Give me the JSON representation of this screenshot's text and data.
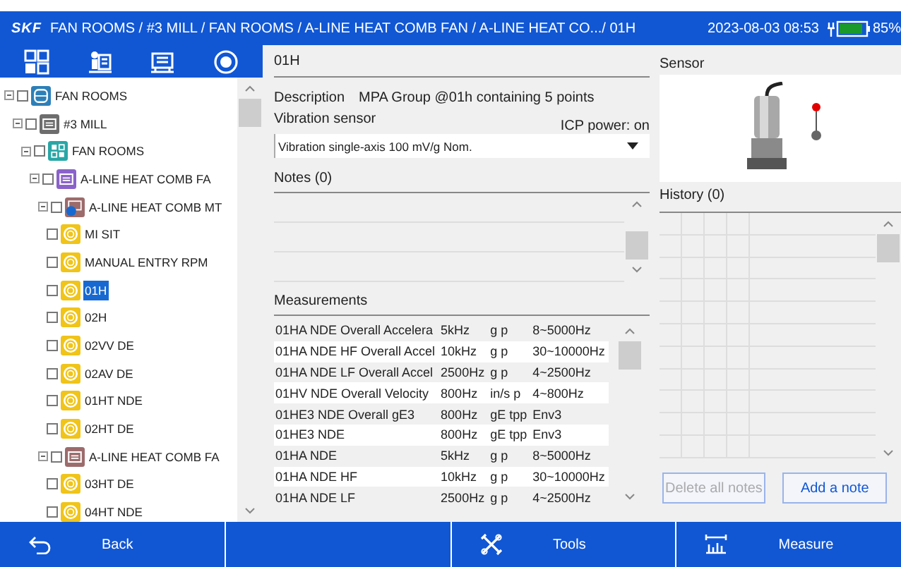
{
  "header": {
    "logo": "SKF",
    "breadcrumb": "FAN ROOMS / #3 MILL / FAN ROOMS / A-LINE HEAT COMB FAN / A-LINE HEAT CO.../ 01H",
    "datetime": "2023-08-03 08:53",
    "battery": "85%"
  },
  "toolbar": [
    {
      "kind": "grid"
    },
    {
      "kind": "machine"
    },
    {
      "kind": "equipment"
    },
    {
      "kind": "target"
    }
  ],
  "tree": [
    {
      "label": "FAN ROOMS",
      "kind": "database",
      "expanded": true,
      "checked": false,
      "selected": false,
      "children": [
        {
          "label": "#3 MILL",
          "kind": "plant",
          "expanded": true,
          "checked": false,
          "selected": false,
          "children": [
            {
              "label": "FAN ROOMS",
              "kind": "group",
              "expanded": true,
              "checked": false,
              "selected": false,
              "children": [
                {
                  "label": "A-LINE HEAT COMB FA",
                  "kind": "machine",
                  "expanded": true,
                  "checked": false,
                  "selected": false,
                  "children": [
                    {
                      "label": "A-LINE HEAT COMB MT",
                      "kind": "submachine",
                      "expanded": true,
                      "checked": false,
                      "selected": false,
                      "children": [
                        {
                          "label": "MI SIT",
                          "kind": "point",
                          "checked": false,
                          "selected": false
                        },
                        {
                          "label": "MANUAL ENTRY RPM",
                          "kind": "point",
                          "checked": false,
                          "selected": false
                        },
                        {
                          "label": "01H",
                          "kind": "point",
                          "checked": false,
                          "selected": true
                        },
                        {
                          "label": "02H",
                          "kind": "point",
                          "checked": false,
                          "selected": false
                        },
                        {
                          "label": "02VV DE",
                          "kind": "point",
                          "checked": false,
                          "selected": false
                        },
                        {
                          "label": "02AV DE",
                          "kind": "point",
                          "checked": false,
                          "selected": false
                        },
                        {
                          "label": "01HT NDE",
                          "kind": "point",
                          "checked": false,
                          "selected": false
                        },
                        {
                          "label": "02HT DE",
                          "kind": "point",
                          "checked": false,
                          "selected": false
                        }
                      ]
                    },
                    {
                      "label": "A-LINE HEAT COMB FA",
                      "kind": "component",
                      "expanded": true,
                      "checked": false,
                      "selected": false,
                      "children": [
                        {
                          "label": "03HT DE",
                          "kind": "point",
                          "checked": false,
                          "selected": false
                        },
                        {
                          "label": "04HT NDE",
                          "kind": "point",
                          "checked": false,
                          "selected": false
                        }
                      ]
                    }
                  ]
                }
              ]
            }
          ]
        }
      ]
    }
  ],
  "detail": {
    "title": "01H",
    "description_label": "Description",
    "description": "MPA Group @01h containing 5 points",
    "sensor_label": "Vibration sensor",
    "icp_power": "ICP power: on",
    "sensor_select": "Vibration single-axis 100 mV/g Nom.",
    "notes_label": "Notes (0)",
    "measurements_label": "Measurements",
    "measurements": [
      [
        "01HA NDE Overall Accelera",
        "5kHz",
        "g p",
        "8~5000Hz"
      ],
      [
        "01HA NDE HF Overall Accel",
        "10kHz",
        "g p",
        "30~10000Hz"
      ],
      [
        "01HA NDE LF Overall Accel",
        "2500Hz",
        "g p",
        "4~2500Hz"
      ],
      [
        "01HV NDE Overall Velocity",
        "800Hz",
        "in/s p",
        "4~800Hz"
      ],
      [
        "01HE3 NDE Overall gE3",
        "800Hz",
        "gE tpp",
        "Env3"
      ],
      [
        "01HE3 NDE",
        "800Hz",
        "gE tpp",
        "Env3"
      ],
      [
        "01HA NDE",
        "5kHz",
        "g p",
        "8~5000Hz"
      ],
      [
        "01HA NDE HF",
        "10kHz",
        "g p",
        "30~10000Hz"
      ],
      [
        "01HA NDE LF",
        "2500Hz",
        "g p",
        "4~2500Hz"
      ]
    ]
  },
  "side": {
    "sensor_label": "Sensor",
    "history_label": "History (0)",
    "buttons": [
      {
        "label": "Delete all notes",
        "disabled": true
      },
      {
        "label": "Add a note",
        "disabled": false
      }
    ]
  },
  "footer": [
    {
      "label": "Back",
      "kind": "back"
    },
    {
      "kind": "blank"
    },
    {
      "label": "Tools",
      "kind": "tools"
    },
    {
      "label": "Measure",
      "kind": "measure"
    }
  ]
}
